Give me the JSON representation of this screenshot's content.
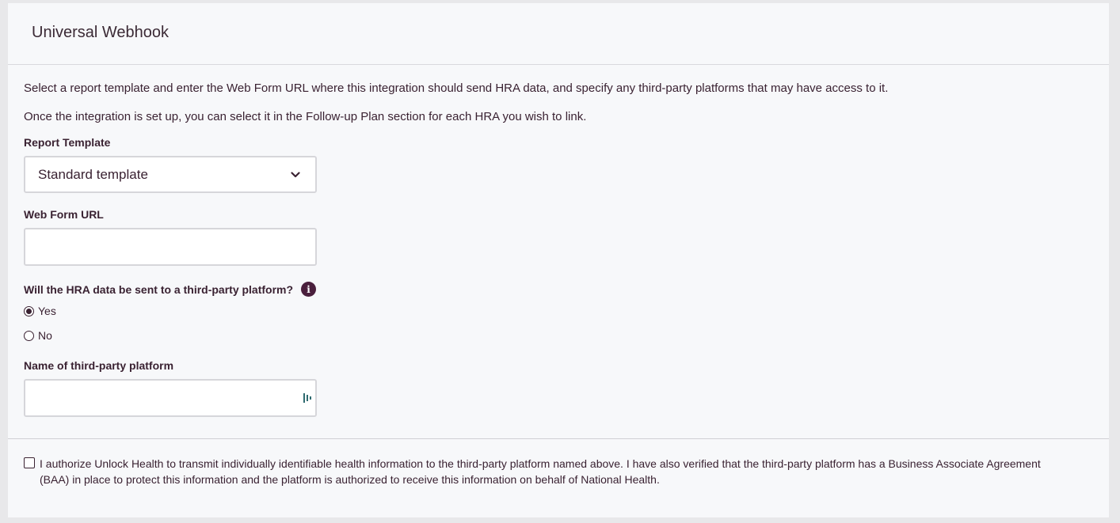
{
  "header": {
    "title": "Universal Webhook"
  },
  "intro": {
    "line1": "Select a report template and enter the Web Form URL where this integration should send HRA data, and specify any third-party platforms that may have access to it.",
    "line2": "Once the integration is set up, you can select it in the Follow-up Plan section for each HRA you wish to link."
  },
  "report_template": {
    "label": "Report Template",
    "selected": "Standard template",
    "icon": "chevron-down-icon"
  },
  "web_form_url": {
    "label": "Web Form URL",
    "value": "",
    "placeholder": ""
  },
  "third_party_question": {
    "label": "Will the HRA data be sent to a third-party platform?",
    "info_icon": "info-icon",
    "options": [
      {
        "label": "Yes",
        "checked": true
      },
      {
        "label": "No",
        "checked": false
      }
    ]
  },
  "platform_name": {
    "label": "Name of third-party platform",
    "value": "",
    "placeholder": ""
  },
  "consent": {
    "checked": false,
    "text": "I authorize Unlock Health to transmit individually identifiable health information to the third-party platform named above. I have also verified that the third-party platform has a Business Associate Agreement (BAA) in place to protect this information and the platform is authorized to receive this information on behalf of National Health."
  },
  "colors": {
    "text": "#3a2232",
    "info_icon_bg": "#4a1f3c",
    "panel_bg": "#f7f8fa",
    "page_bg": "#e8e8ea",
    "input_border": "#d6d6da"
  }
}
